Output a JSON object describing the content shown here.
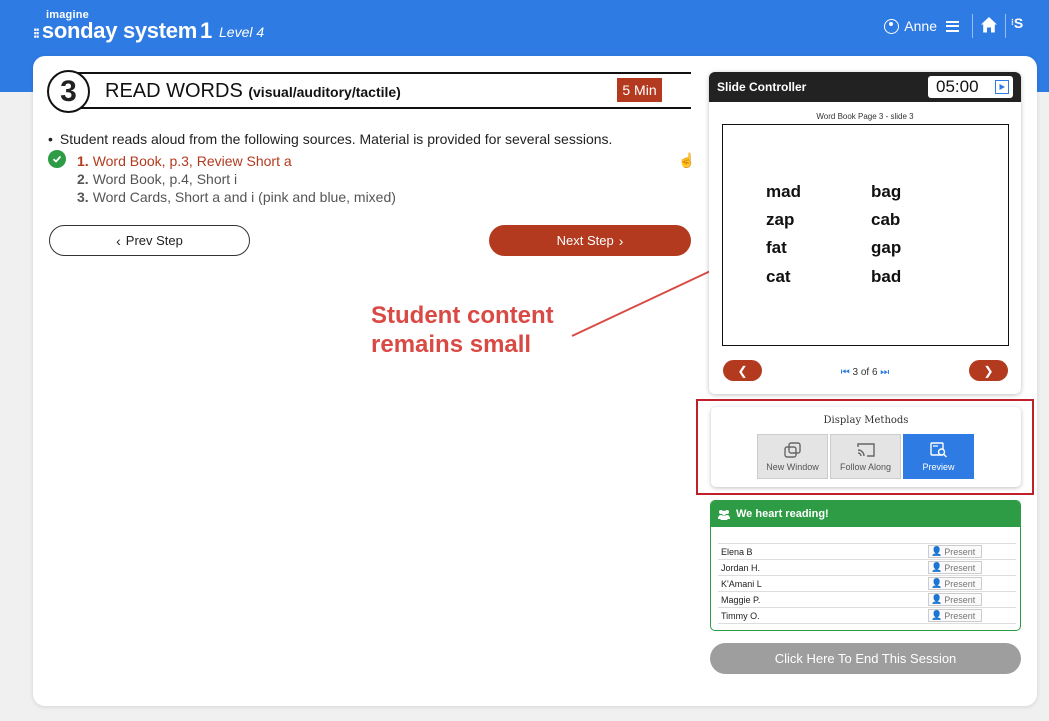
{
  "header": {
    "brand_small": "imagine",
    "brand_main": "sonday system",
    "brand_num": "1",
    "level": "Level 4",
    "user": "Anne",
    "brand_icon_letter": "S"
  },
  "lesson": {
    "step_number": "3",
    "title": "READ WORDS",
    "subtitle": "(visual/auditory/tactile)",
    "duration": "5 Min",
    "instruction": "Student reads aloud from the following sources. Material is provided for several sessions.",
    "sources": [
      {
        "num": "1.",
        "text": "Word Book, p.3, Review Short a"
      },
      {
        "num": "2.",
        "text": "Word Book, p.4, Short i"
      },
      {
        "num": "3.",
        "text": "Word Cards, Short a and i (pink and blue, mixed)"
      }
    ],
    "prev_label": "Prev Step",
    "next_label": "Next Step"
  },
  "annotation": {
    "line1": "Student content",
    "line2": "remains small"
  },
  "slide_controller": {
    "label": "Slide Controller",
    "timer": "05:00",
    "caption": "Word Book Page 3 - slide 3",
    "words_col1": [
      "mad",
      "zap",
      "fat",
      "cat"
    ],
    "words_col2": [
      "bag",
      "cab",
      "gap",
      "bad"
    ],
    "pager": "3 of 6"
  },
  "display_methods": {
    "title": "Display Methods",
    "options": [
      {
        "label": "New Window",
        "active": false
      },
      {
        "label": "Follow Along",
        "active": false
      },
      {
        "label": "Preview",
        "active": true
      }
    ]
  },
  "class": {
    "name": "We heart reading!",
    "students": [
      {
        "name": "Elena B",
        "status": "Present"
      },
      {
        "name": "Jordan H.",
        "status": "Present"
      },
      {
        "name": "K'Amani L",
        "status": "Present"
      },
      {
        "name": "Maggie P.",
        "status": "Present"
      },
      {
        "name": "Timmy O.",
        "status": "Present"
      }
    ]
  },
  "end_session_label": "Click Here To End This Session",
  "colors": {
    "header_blue": "#2e7be4",
    "accent_rust": "#b33a1f",
    "check_green": "#2e9b45",
    "annotation_red": "#d94a45"
  }
}
